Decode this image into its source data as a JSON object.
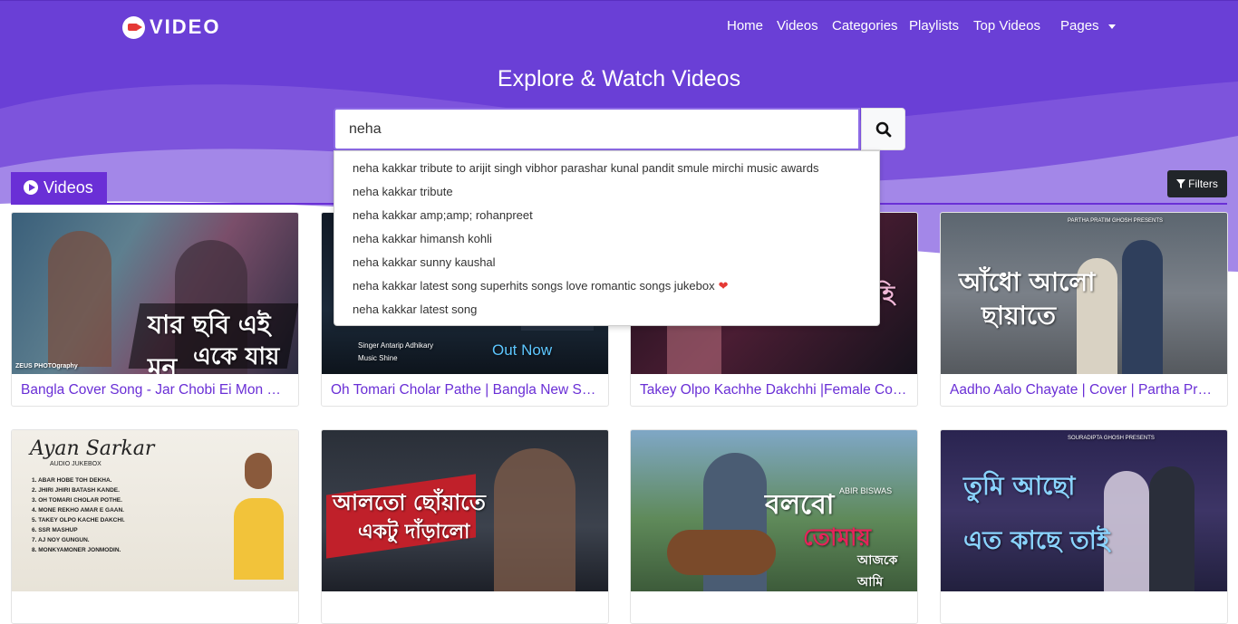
{
  "brand": {
    "name": "VIDEO"
  },
  "nav": {
    "items": [
      "Home",
      "Videos",
      "Categories",
      "Playlists",
      "Top Videos",
      "Pages"
    ]
  },
  "hero": {
    "title": "Explore & Watch Videos"
  },
  "search": {
    "value": "neha"
  },
  "suggestions": [
    "neha kakkar tribute to arijit singh vibhor parashar kunal pandit smule mirchi music awards",
    "neha kakkar tribute",
    "neha kakkar amp;amp; rohanpreet",
    "neha kakkar himansh kohli",
    "neha kakkar sunny kaushal",
    "neha kakkar latest song superhits songs love romantic songs jukebox",
    "neha kakkar latest song"
  ],
  "section": {
    "videos_label": "Videos",
    "filters_label": "Filters"
  },
  "videos": [
    {
      "title": "Bangla Cover Song - Jar Chobi Ei Mon Eke Jay"
    },
    {
      "title": "Oh Tomari Cholar Pathe | Bangla New Song"
    },
    {
      "title": "Takey Olpo Kachhe Dakchhi |Female Cover"
    },
    {
      "title": "Aadho Aalo Chayate | Cover | Partha Pratim"
    },
    {
      "title": ""
    },
    {
      "title": ""
    },
    {
      "title": ""
    },
    {
      "title": ""
    }
  ],
  "thumb_text": {
    "t1_lines": [
      "ZEUS PHOTOgraphy"
    ],
    "t2_credits": [
      "Singer  Antarip Adhikary",
      "Music  Shine"
    ],
    "t2_cta": "Out Now",
    "t4_presents": "PARTHA PRATIM GHOSH PRESENTS",
    "t5_name": "Ayan Sarkar",
    "t5_sub": "AUDIO JUKEBOX",
    "t5_list": [
      "1. ABAR HOBE TOH DEKHA.",
      "2. JHIRI JHIRI BATASH KANDE.",
      "3. OH TOMARI CHOLAR POTHE.",
      "4. MONE REKHO AMAR E GAAN.",
      "5. TAKEY OLPO KACHE DAKCHI.",
      "6. SSR MASHUP",
      "7. AJ NOY GUNGUN.",
      "8. MONKYAMONER JONMODIN."
    ],
    "t7_name": "ABIR BISWAS",
    "t8_presents": "SOURADIPTA GHOSH PRESENTS"
  },
  "colors": {
    "primary": "#6a2fd6",
    "hero": "#6a3fd6",
    "heart": "#e53935"
  }
}
